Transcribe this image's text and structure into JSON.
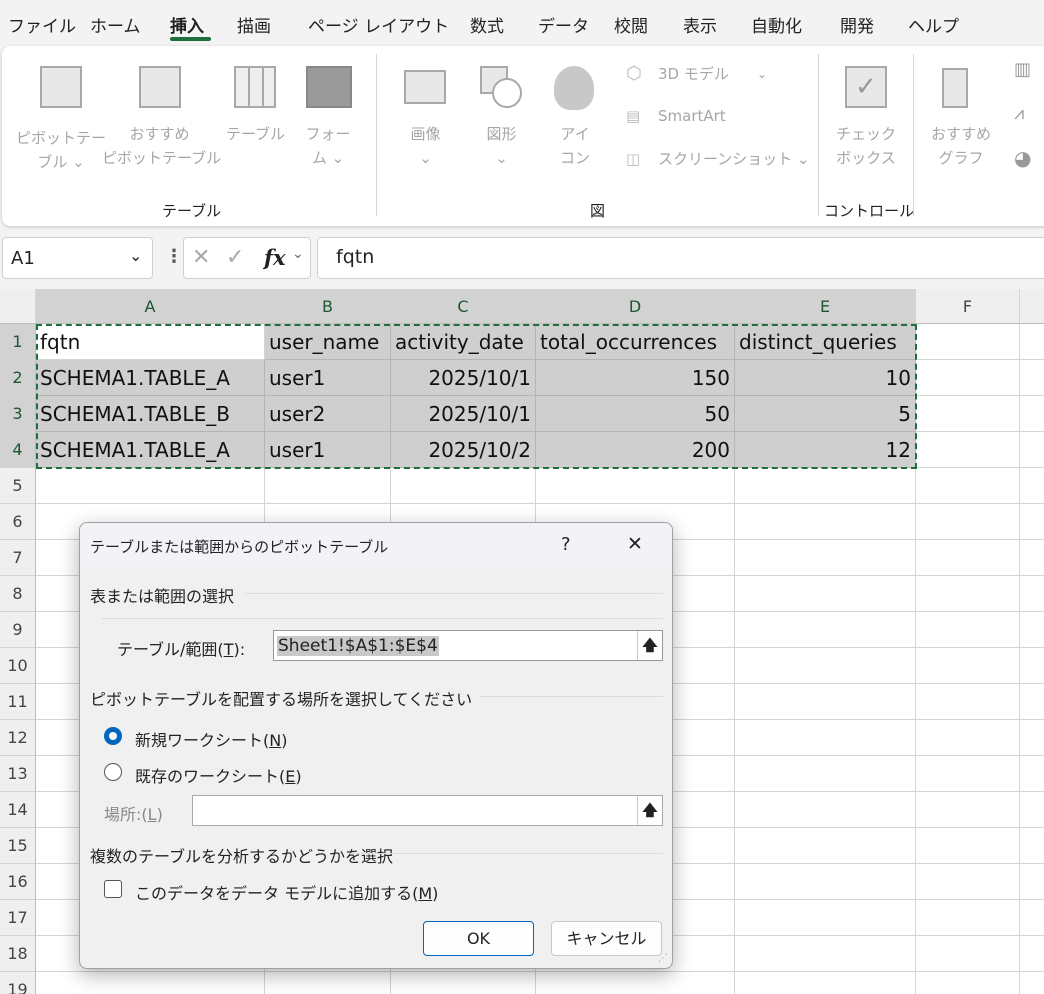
{
  "menu": {
    "tabs": [
      "ファイル",
      "ホーム",
      "挿入",
      "描画",
      "ページ レイアウト",
      "数式",
      "データ",
      "校閲",
      "表示",
      "自動化",
      "開発",
      "ヘルプ"
    ],
    "active": "挿入"
  },
  "ribbon": {
    "pivot_table": [
      "ピボットテー",
      "ブル ⌄"
    ],
    "recommended_pivot": [
      "おすすめ",
      "ピボットテーブル"
    ],
    "table": "テーブル",
    "form": [
      "フォー",
      "ム ⌄"
    ],
    "group_table": "テーブル",
    "image": [
      "画像",
      "⌄"
    ],
    "shapes": [
      "図形",
      "⌄"
    ],
    "icons": [
      "アイ",
      "コン"
    ],
    "model3d": "3D モデル",
    "smartart": "SmartArt",
    "screenshot": "スクリーンショット ⌄",
    "group_figure": "図",
    "checkbox": [
      "チェック",
      "ボックス"
    ],
    "group_control": "コントロール",
    "recommended_chart": [
      "おすすめ",
      "グラフ"
    ]
  },
  "formula_bar": {
    "name_box": "A1",
    "fx": "fx",
    "formula": "fqtn"
  },
  "sheet": {
    "columns": [
      "A",
      "B",
      "C",
      "D",
      "E",
      "F"
    ],
    "rows": [
      "1",
      "2",
      "3",
      "4",
      "5",
      "6",
      "7",
      "8",
      "9",
      "10",
      "11",
      "12",
      "13",
      "14",
      "15",
      "16",
      "17",
      "18",
      "19"
    ],
    "data": [
      [
        "fqtn",
        "user_name",
        "activity_date",
        "total_occurrences",
        "distinct_queries"
      ],
      [
        "SCHEMA1.TABLE_A",
        "user1",
        "2025/10/1",
        "150",
        "10"
      ],
      [
        "SCHEMA1.TABLE_B",
        "user2",
        "2025/10/1",
        "50",
        "5"
      ],
      [
        "SCHEMA1.TABLE_A",
        "user1",
        "2025/10/2",
        "200",
        "12"
      ]
    ]
  },
  "dialog": {
    "title": "テーブルまたは範囲からのピボットテーブル",
    "help": "?",
    "close": "✕",
    "section1": "表または範囲の選択",
    "range_label": "テーブル/範囲(",
    "range_key": "T",
    "range_suffix": "):",
    "range_value": "Sheet1!$A$1:$E$4",
    "section2": "ピボットテーブルを配置する場所を選択してください",
    "new_sheet": "新規ワークシート(",
    "new_sheet_key": "N",
    "existing_sheet": "既存のワークシート(",
    "existing_sheet_key": "E",
    "location_label": "場所:(",
    "location_key": "L",
    "location_value": "",
    "section3": "複数のテーブルを分析するかどうかを選択",
    "data_model": "このデータをデータ モデルに追加する(",
    "data_model_key": "M",
    "ok": "OK",
    "cancel": "キャンセル",
    "close_paren": ")",
    "selected_option": "new_sheet",
    "data_model_checked": false
  },
  "colors": {
    "accent": "#1e6e3e",
    "radio": "#0067c0"
  }
}
